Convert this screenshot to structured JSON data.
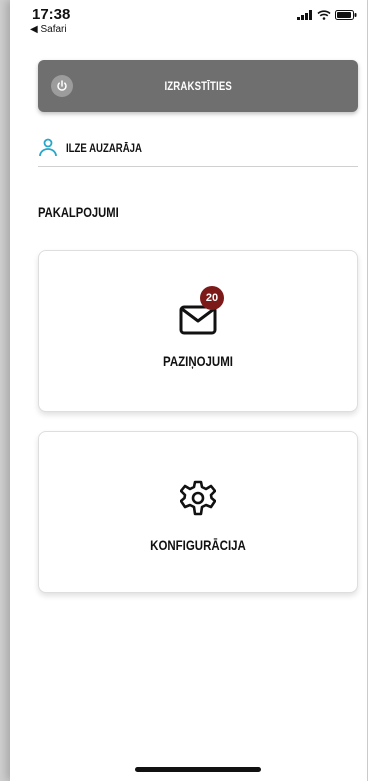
{
  "status_bar": {
    "time": "17:38",
    "back_label": "◀ Safari"
  },
  "logout": {
    "label": "IZRAKSTĪTIES"
  },
  "user": {
    "name": "ILZE AUZARĀJA"
  },
  "section": {
    "title": "PAKALPOJUMI"
  },
  "cards": [
    {
      "label": "PAZIŅOJUMI",
      "badge": "20",
      "icon": "envelope-icon"
    },
    {
      "label": "KONFIGURĀCIJA",
      "icon": "gear-icon"
    }
  ],
  "colors": {
    "logout_bg": "#6f6f6f",
    "badge_bg": "#7c1a1a",
    "user_icon": "#27a6c9"
  }
}
